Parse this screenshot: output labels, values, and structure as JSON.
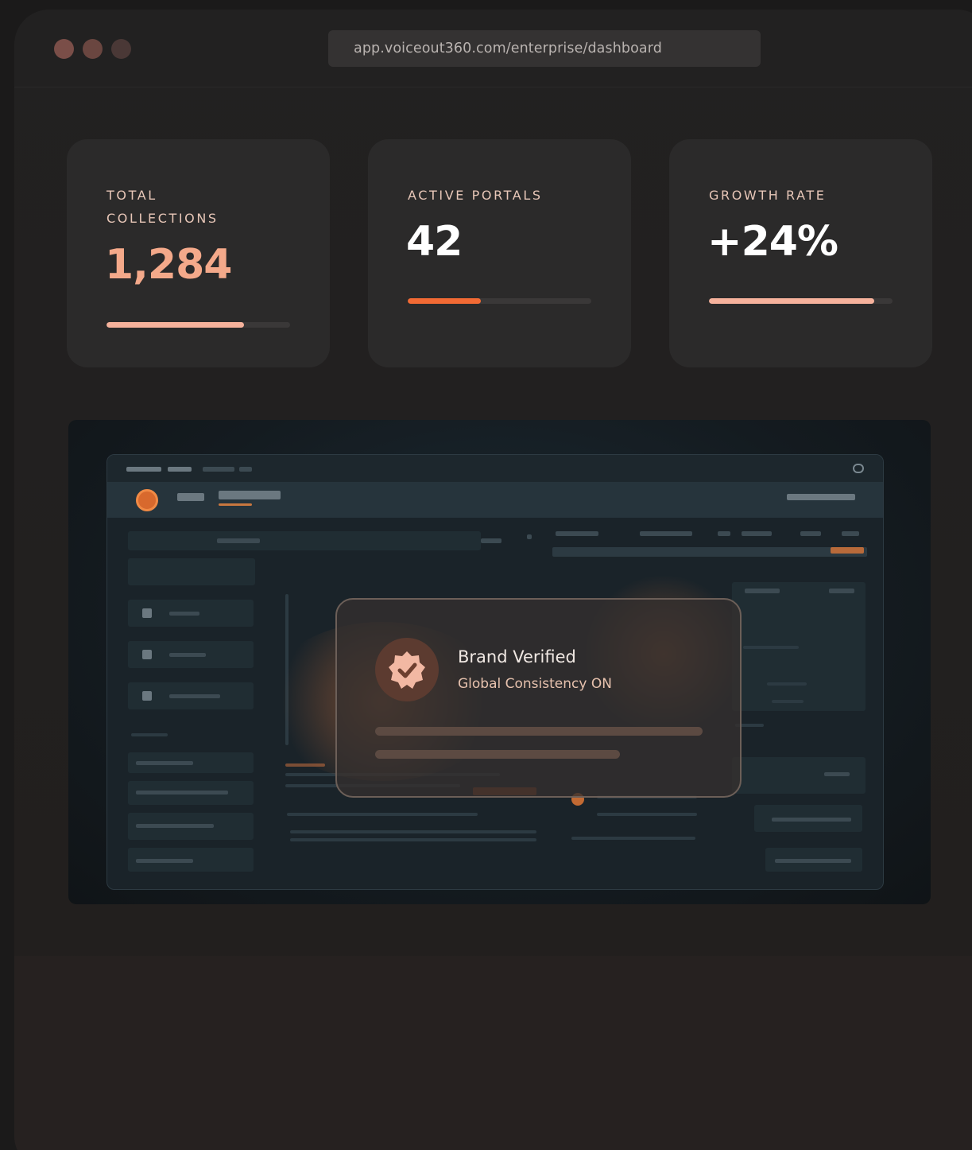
{
  "browser": {
    "url": "app.voiceout360.com/enterprise/dashboard"
  },
  "stats": [
    {
      "label": "TOTAL COLLECTIONS",
      "value": "1,284",
      "progress": 0.75,
      "value_color": "#f4a98a",
      "bar_color": "#f6b29c"
    },
    {
      "label": "ACTIVE PORTALS",
      "value": "42",
      "progress": 0.4,
      "value_color": "#ffffff",
      "bar_color": "#f26a34"
    },
    {
      "label": "GROWTH RATE",
      "value": "+24%",
      "progress": 0.9,
      "value_color": "#ffffff",
      "bar_color": "#f6b29c"
    }
  ],
  "modal": {
    "title": "Brand Verified",
    "subtitle": "Global Consistency ON",
    "icon": "verified-badge-icon"
  },
  "colors": {
    "accent": "#f26a34",
    "accent_light": "#f6b29c",
    "background": "#1b1a1a",
    "card": "#2b2a2a"
  }
}
